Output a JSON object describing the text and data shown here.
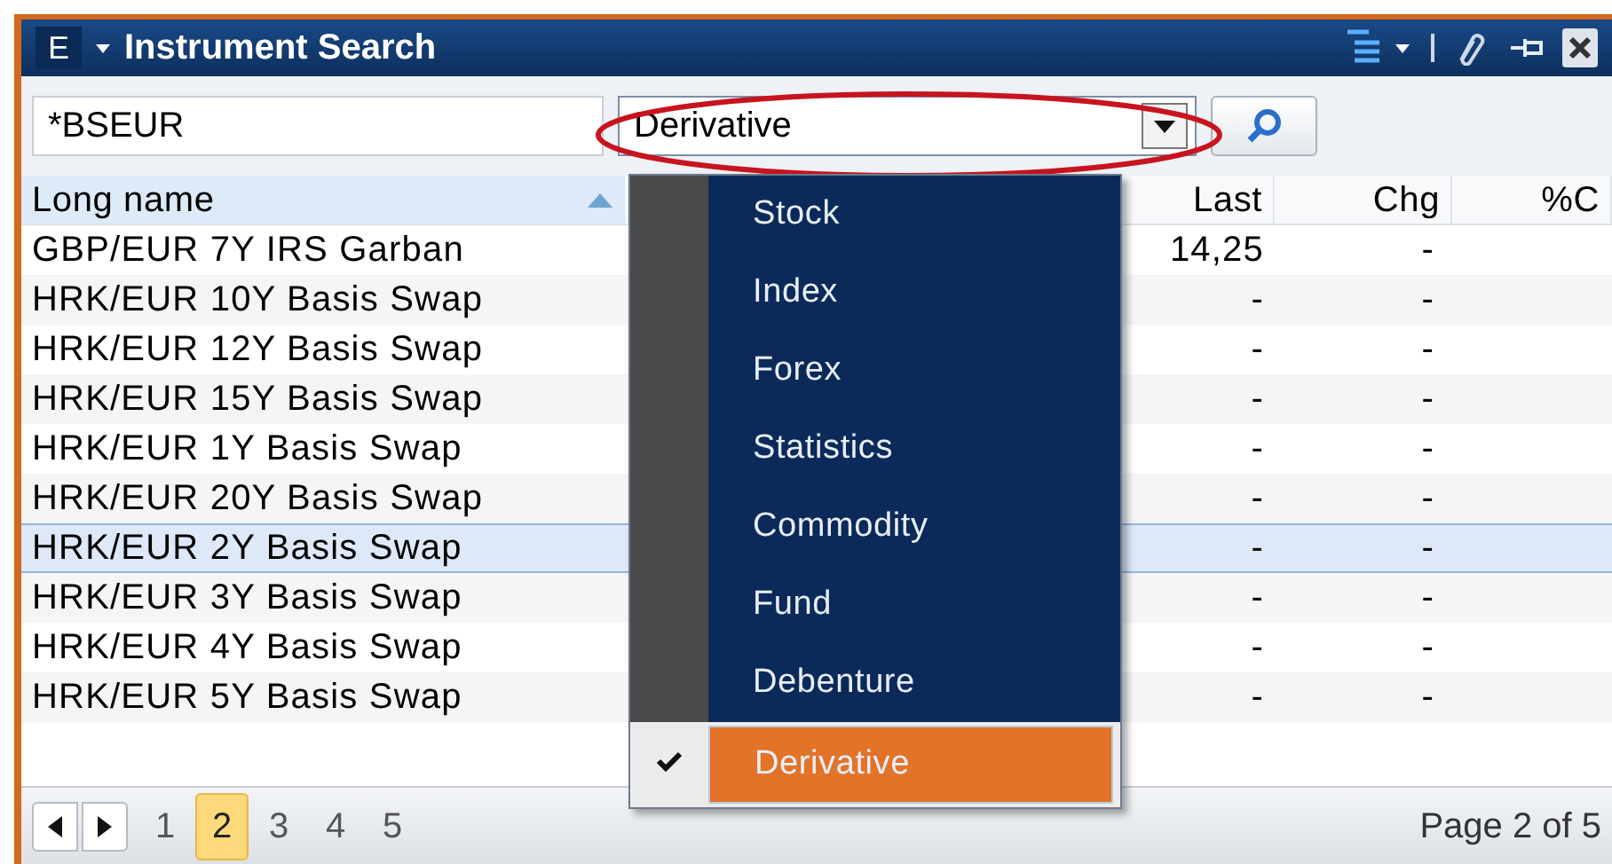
{
  "window": {
    "badge": "E",
    "title": "Instrument Search"
  },
  "search": {
    "value": "*BSEUR"
  },
  "type_select": {
    "value": "Derivative",
    "open": true
  },
  "menu": {
    "items": [
      {
        "label": "Stock",
        "selected": false
      },
      {
        "label": "Index",
        "selected": false
      },
      {
        "label": "Forex",
        "selected": false
      },
      {
        "label": "Statistics",
        "selected": false
      },
      {
        "label": "Commodity",
        "selected": false
      },
      {
        "label": "Fund",
        "selected": false
      },
      {
        "label": "Debenture",
        "selected": false
      },
      {
        "label": "Derivative",
        "selected": true
      }
    ]
  },
  "table": {
    "columns": [
      {
        "label": "Long name",
        "sorted": true
      },
      {
        "label": "Last",
        "sorted": false
      },
      {
        "label": "Chg",
        "sorted": false
      },
      {
        "label": "%C",
        "sorted": false
      }
    ],
    "rows": [
      {
        "long_name": "GBP/EUR 7Y IRS Garban",
        "last": "14,25",
        "chg": "-",
        "selected": false
      },
      {
        "long_name": "HRK/EUR 10Y Basis Swap",
        "last": "-",
        "chg": "-",
        "selected": false
      },
      {
        "long_name": "HRK/EUR 12Y Basis Swap",
        "last": "-",
        "chg": "-",
        "selected": false
      },
      {
        "long_name": "HRK/EUR 15Y Basis Swap",
        "last": "-",
        "chg": "-",
        "selected": false
      },
      {
        "long_name": "HRK/EUR 1Y Basis Swap",
        "last": "-",
        "chg": "-",
        "selected": false
      },
      {
        "long_name": "HRK/EUR 20Y Basis Swap",
        "last": "-",
        "chg": "-",
        "selected": false
      },
      {
        "long_name": "HRK/EUR 2Y Basis Swap",
        "last": "-",
        "chg": "-",
        "selected": true
      },
      {
        "long_name": "HRK/EUR 3Y Basis Swap",
        "last": "-",
        "chg": "-",
        "selected": false
      },
      {
        "long_name": "HRK/EUR 4Y Basis Swap",
        "last": "-",
        "chg": "-",
        "selected": false
      },
      {
        "long_name": "HRK/EUR 5Y Basis Swap",
        "last": "-",
        "chg": "-",
        "selected": false
      }
    ]
  },
  "pager": {
    "pages": [
      {
        "label": "1",
        "selected": false
      },
      {
        "label": "2",
        "selected": true
      },
      {
        "label": "3",
        "selected": false
      },
      {
        "label": "4",
        "selected": false
      },
      {
        "label": "5",
        "selected": false
      }
    ],
    "status": "Page 2 of 5"
  }
}
